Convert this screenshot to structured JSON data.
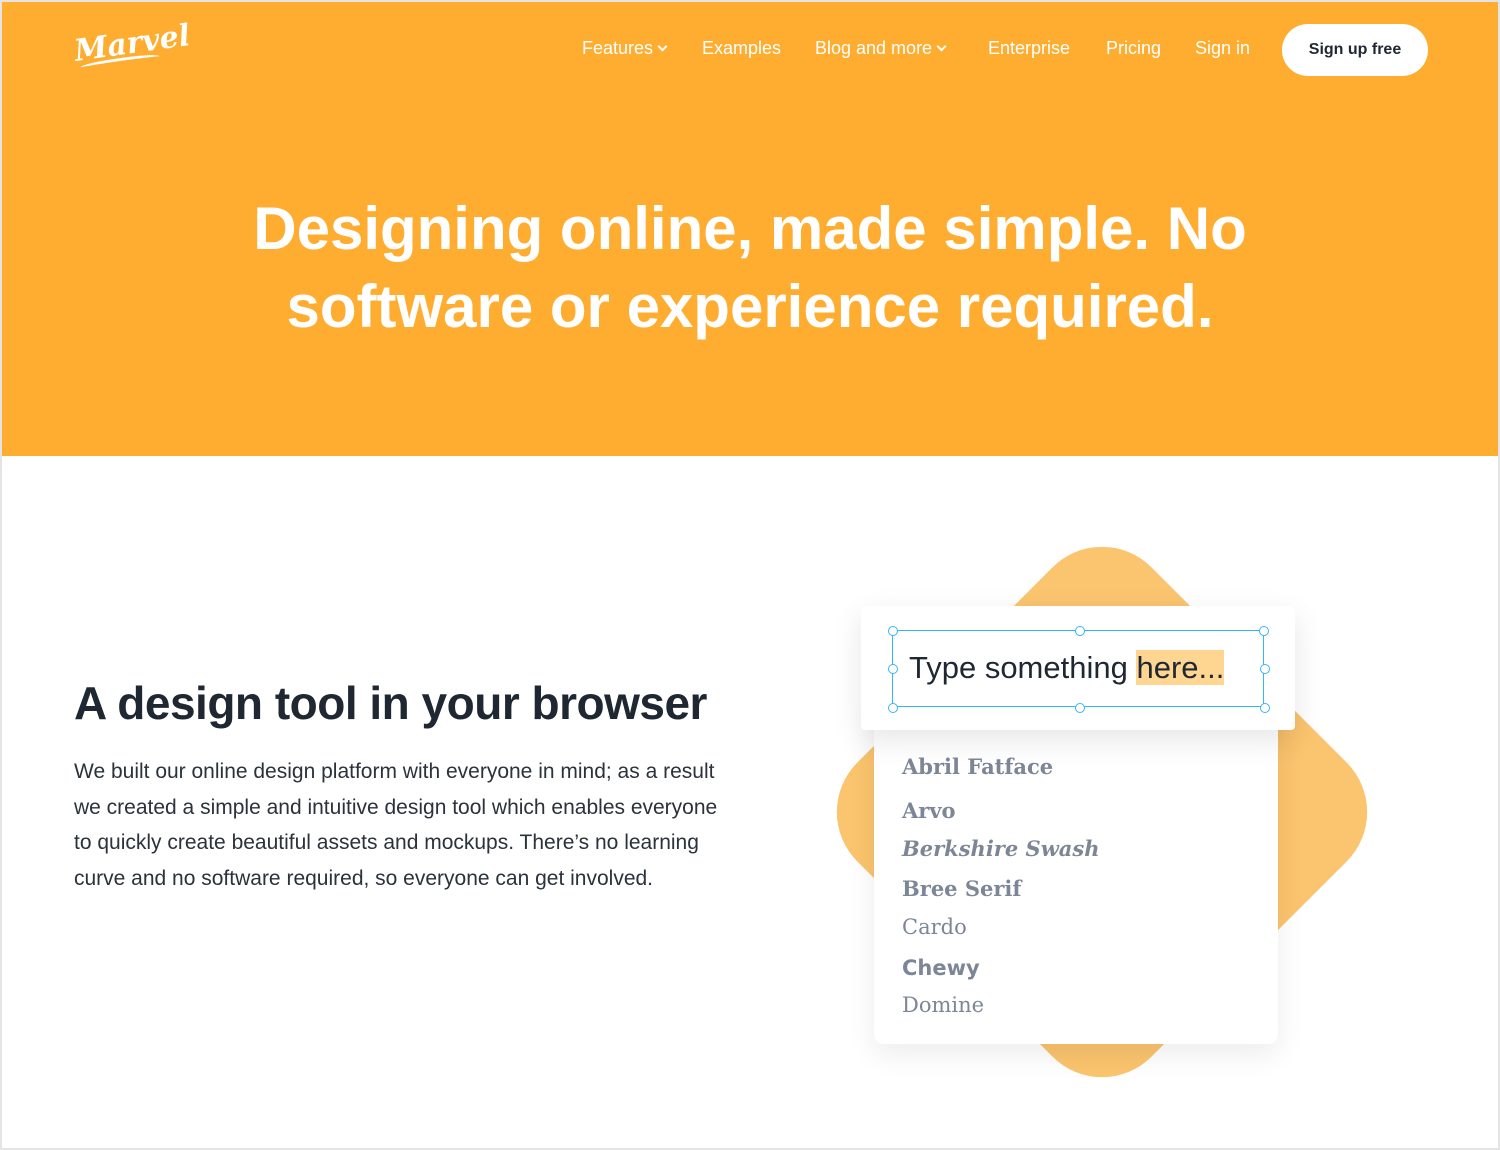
{
  "nav": {
    "logo": "Marvel",
    "items": [
      {
        "label": "Features",
        "dropdown": true
      },
      {
        "label": "Examples"
      },
      {
        "label": "Blog and more",
        "dropdown": true
      },
      {
        "label": "Enterprise"
      },
      {
        "label": "Pricing"
      },
      {
        "label": "Sign in"
      }
    ],
    "signup": "Sign up free"
  },
  "hero": {
    "headline_line1": "Designing online, made simple. No",
    "headline_line2": "software or experience required."
  },
  "section": {
    "title": "A design tool in your browser",
    "body": "We built our online design platform with everyone in mind; as a result we created a simple and intuitive design tool which enables everyone to quickly create beautiful assets and mockups. There’s no learning curve and no software required, so everyone can get involved."
  },
  "illustration": {
    "text_before": "Type something ",
    "text_highlight": "here...",
    "fonts": [
      "Abril Fatface",
      "Arvo",
      "Berkshire Swash",
      "Bree Serif",
      "Cardo",
      "Chewy",
      "Domine"
    ]
  },
  "colors": {
    "brand": "#ffad31",
    "selection": "#38b6f1",
    "highlight": "#ffd592"
  }
}
